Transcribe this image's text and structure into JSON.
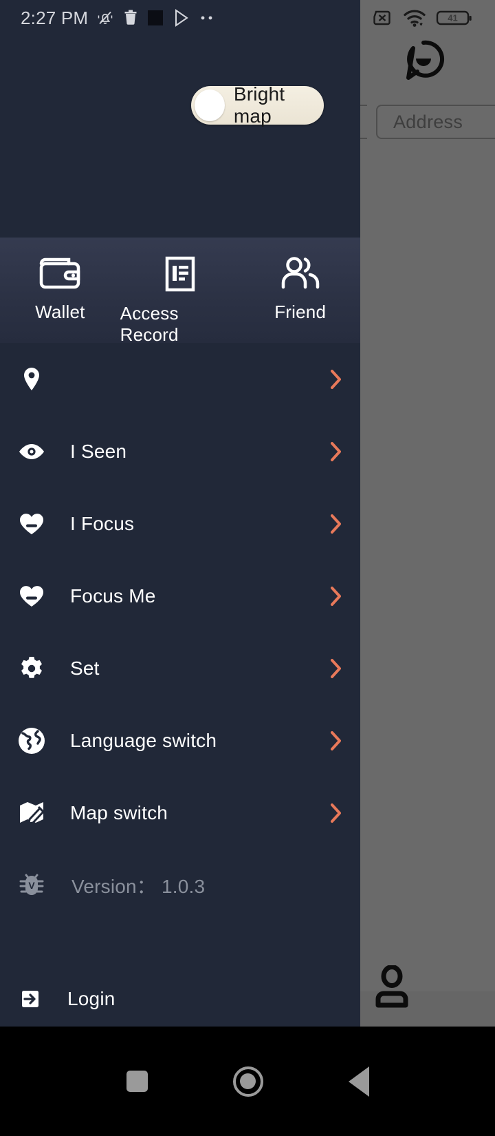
{
  "status_bar": {
    "time": "2:27 PM",
    "left_icons": [
      "notifications-silenced-icon",
      "trash-icon",
      "square-app-icon",
      "play-store-icon",
      "more-dots-icon"
    ],
    "right_icons": [
      "sim-missing-icon",
      "wifi-icon"
    ],
    "battery_level": "41"
  },
  "background_app": {
    "chat_icon": "chat-bubble-icon",
    "address_field": {
      "placeholder": "Address",
      "value": ""
    },
    "profile_icon": "person-icon"
  },
  "bright_map_toggle": {
    "label": "Bright map",
    "state": "off",
    "track_color": "#efe8d8",
    "knob_color": "#ffffff"
  },
  "drawer": {
    "background_color": "#212838",
    "header_shortcuts": [
      {
        "icon": "wallet-icon",
        "label": "Wallet"
      },
      {
        "icon": "document-record-icon",
        "label": "Access Record"
      },
      {
        "icon": "people-icon",
        "label": "Friend"
      }
    ],
    "menu_items": [
      {
        "icon": "location-pin-icon",
        "label": "",
        "chevron": true
      },
      {
        "icon": "eye-icon",
        "label": "I Seen",
        "chevron": true
      },
      {
        "icon": "heart-icon",
        "label": "I Focus",
        "chevron": true
      },
      {
        "icon": "heart-icon",
        "label": "Focus Me",
        "chevron": true
      },
      {
        "icon": "gear-icon",
        "label": "Set",
        "chevron": true
      },
      {
        "icon": "globe-icon",
        "label": "Language switch",
        "chevron": true
      },
      {
        "icon": "map-edit-icon",
        "label": "Map switch",
        "chevron": true
      },
      {
        "icon": "bug-icon",
        "label": "Version： 1.0.3",
        "chevron": false,
        "dim": true
      }
    ],
    "login": {
      "icon": "sign-in-icon",
      "label": "Login"
    },
    "chevron_color": "#e8795a"
  },
  "nav_bar": {
    "buttons": [
      "recents-button",
      "home-button",
      "back-button"
    ],
    "color": "#9a9a9a"
  }
}
